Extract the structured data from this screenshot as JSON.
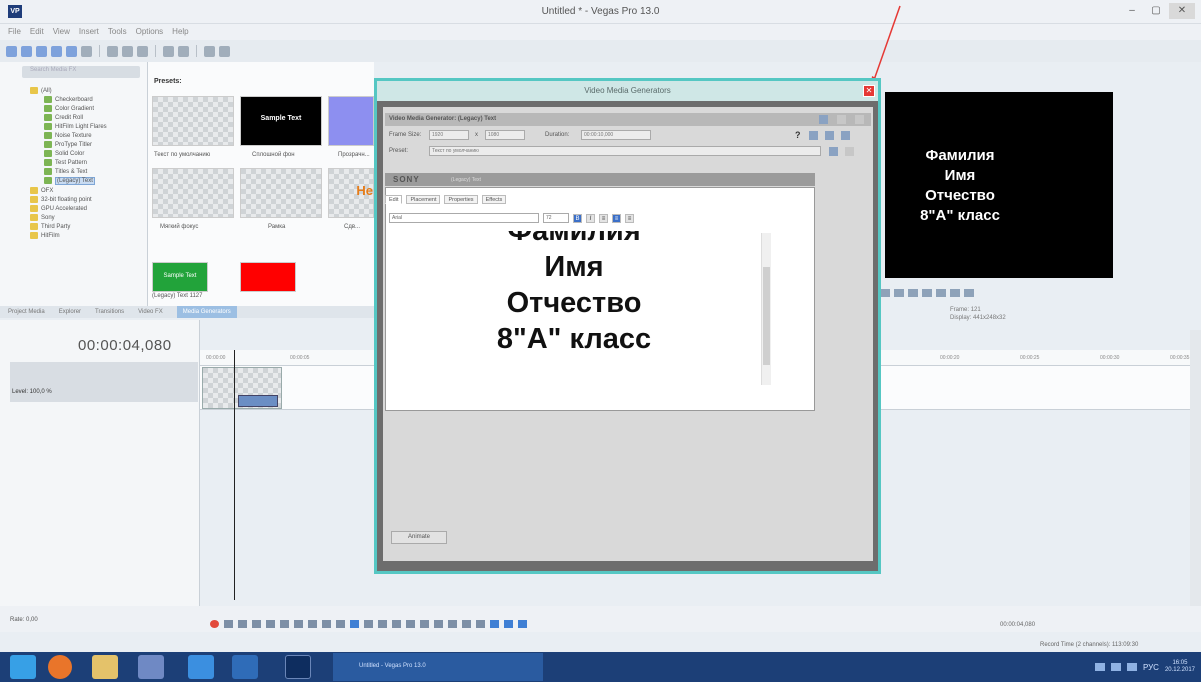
{
  "window": {
    "title": "Untitled * - Vegas Pro 13.0",
    "app_icon": "VP",
    "controls": [
      "–",
      "▢",
      "✕"
    ]
  },
  "menu": [
    "File",
    "Edit",
    "View",
    "Insert",
    "Tools",
    "Options",
    "Help"
  ],
  "explorer": {
    "search_placeholder": "Search Media FX",
    "items": [
      {
        "label": "(All)",
        "icon": "folder-icon"
      },
      {
        "label": "Checkerboard",
        "icon": "generator-icon"
      },
      {
        "label": "Color Gradient",
        "icon": "generator-icon"
      },
      {
        "label": "Credit Roll",
        "icon": "generator-icon"
      },
      {
        "label": "HitFilm Light Flares",
        "icon": "generator-icon"
      },
      {
        "label": "Noise Texture",
        "icon": "generator-icon"
      },
      {
        "label": "ProType Titler",
        "icon": "generator-icon"
      },
      {
        "label": "Solid Color",
        "icon": "generator-icon"
      },
      {
        "label": "Test Pattern",
        "icon": "generator-icon"
      },
      {
        "label": "Titles & Text",
        "icon": "generator-icon"
      },
      {
        "label": "(Legacy) Text",
        "icon": "generator-icon"
      },
      {
        "label": "OFX",
        "icon": "folder-icon"
      },
      {
        "label": "32-bit floating point",
        "icon": "folder-icon"
      },
      {
        "label": "GPU Accelerated",
        "icon": "folder-icon"
      },
      {
        "label": "Sony",
        "icon": "folder-icon"
      },
      {
        "label": "Third Party",
        "icon": "folder-icon"
      },
      {
        "label": "HitFilm",
        "icon": "folder-icon"
      }
    ]
  },
  "presets": {
    "title": "Presets:",
    "items": [
      {
        "label": "Текст по умолчанию",
        "thumb_text": "Sample Text",
        "style": "check"
      },
      {
        "label": "Сплошной фон",
        "thumb_text": "Sample Text",
        "style": "black"
      },
      {
        "label": "Прозрачн...",
        "thumb_text": "",
        "style": "purple"
      },
      {
        "label": "Мягкий фокус",
        "thumb_text": "",
        "style": "check"
      },
      {
        "label": "Рамка",
        "thumb_text": "",
        "style": "check"
      },
      {
        "label": "Сдв...",
        "thumb_text": "He",
        "style": "check"
      },
      {
        "label": "(Legacy) Text 1127",
        "thumb_text": "Sample Text",
        "style": "green"
      },
      {
        "label": "",
        "thumb_text": "",
        "style": "red"
      }
    ]
  },
  "panel_tabs": [
    "Project Media",
    "Explorer",
    "Transitions",
    "Video FX",
    "Media Generators"
  ],
  "preview": {
    "lines": [
      "Фамилия",
      "Имя",
      "Отчество",
      "8\"А\" класс"
    ],
    "frame_label": "Frame:",
    "frame_value": "121",
    "display_label": "Display:",
    "display_value": "441x248x32"
  },
  "timeline": {
    "timecode": "00:00:04,080",
    "track_level": "Level: 100,0 %",
    "ruler_ticks": [
      "00:00:00",
      "00:00:05",
      "00:00:10",
      "00:00:15",
      "00:00:20",
      "00:00:25",
      "00:00:30",
      "00:00:35"
    ],
    "rate": "Rate: 0,00",
    "tc_right": "00:00:04,080",
    "record_time": "Record Time (2 channels): 113:09:30"
  },
  "dialog": {
    "title": "Video Media Generators",
    "generator_label": "Video Media Generator: (Legacy) Text",
    "frame_size_label": "Frame Size:",
    "frame_w": "1920",
    "frame_h": "1080",
    "duration_label": "Duration:",
    "duration": "00:00:10,000",
    "preset_label": "Preset:",
    "preset_value": "Текст по умолчанию",
    "brand": "SONY",
    "plugin_label": "(Legacy) Text",
    "editor_tabs": [
      "Edit",
      "Placement",
      "Properties",
      "Effects"
    ],
    "font_name": "Arial",
    "font_size": "72",
    "bold": "B",
    "italic": "I",
    "editor_lines": [
      "Фамилия",
      "Имя",
      "Отчество",
      "8\"А\" класс"
    ],
    "animate_label": "Animate"
  },
  "taskbar": {
    "active_task": "Untitled - Vegas Pro 13.0",
    "lang": "РУС",
    "time": "16:05",
    "date": "20.12.2017"
  },
  "colors": {
    "dialog_border": "#55c7c3",
    "close_red": "#e53935",
    "taskbar": "#1c3f77"
  }
}
